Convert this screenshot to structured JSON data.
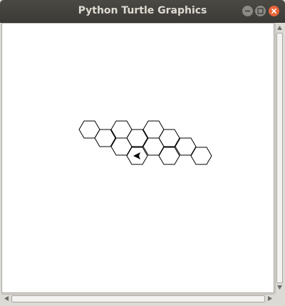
{
  "window": {
    "title": "Python Turtle Graphics",
    "controls": [
      "minimize-icon",
      "maximize-icon",
      "close-icon"
    ],
    "accent_close": "#e8643a"
  },
  "canvas": {
    "background": "#ffffff",
    "stroke": "#000000",
    "shape": "hexagon",
    "hexagon_count": 13,
    "turtle_cursor": "arrow-icon"
  },
  "scrollbars": {
    "vertical": "scrollbar-vertical",
    "horizontal": "scrollbar-horizontal"
  }
}
